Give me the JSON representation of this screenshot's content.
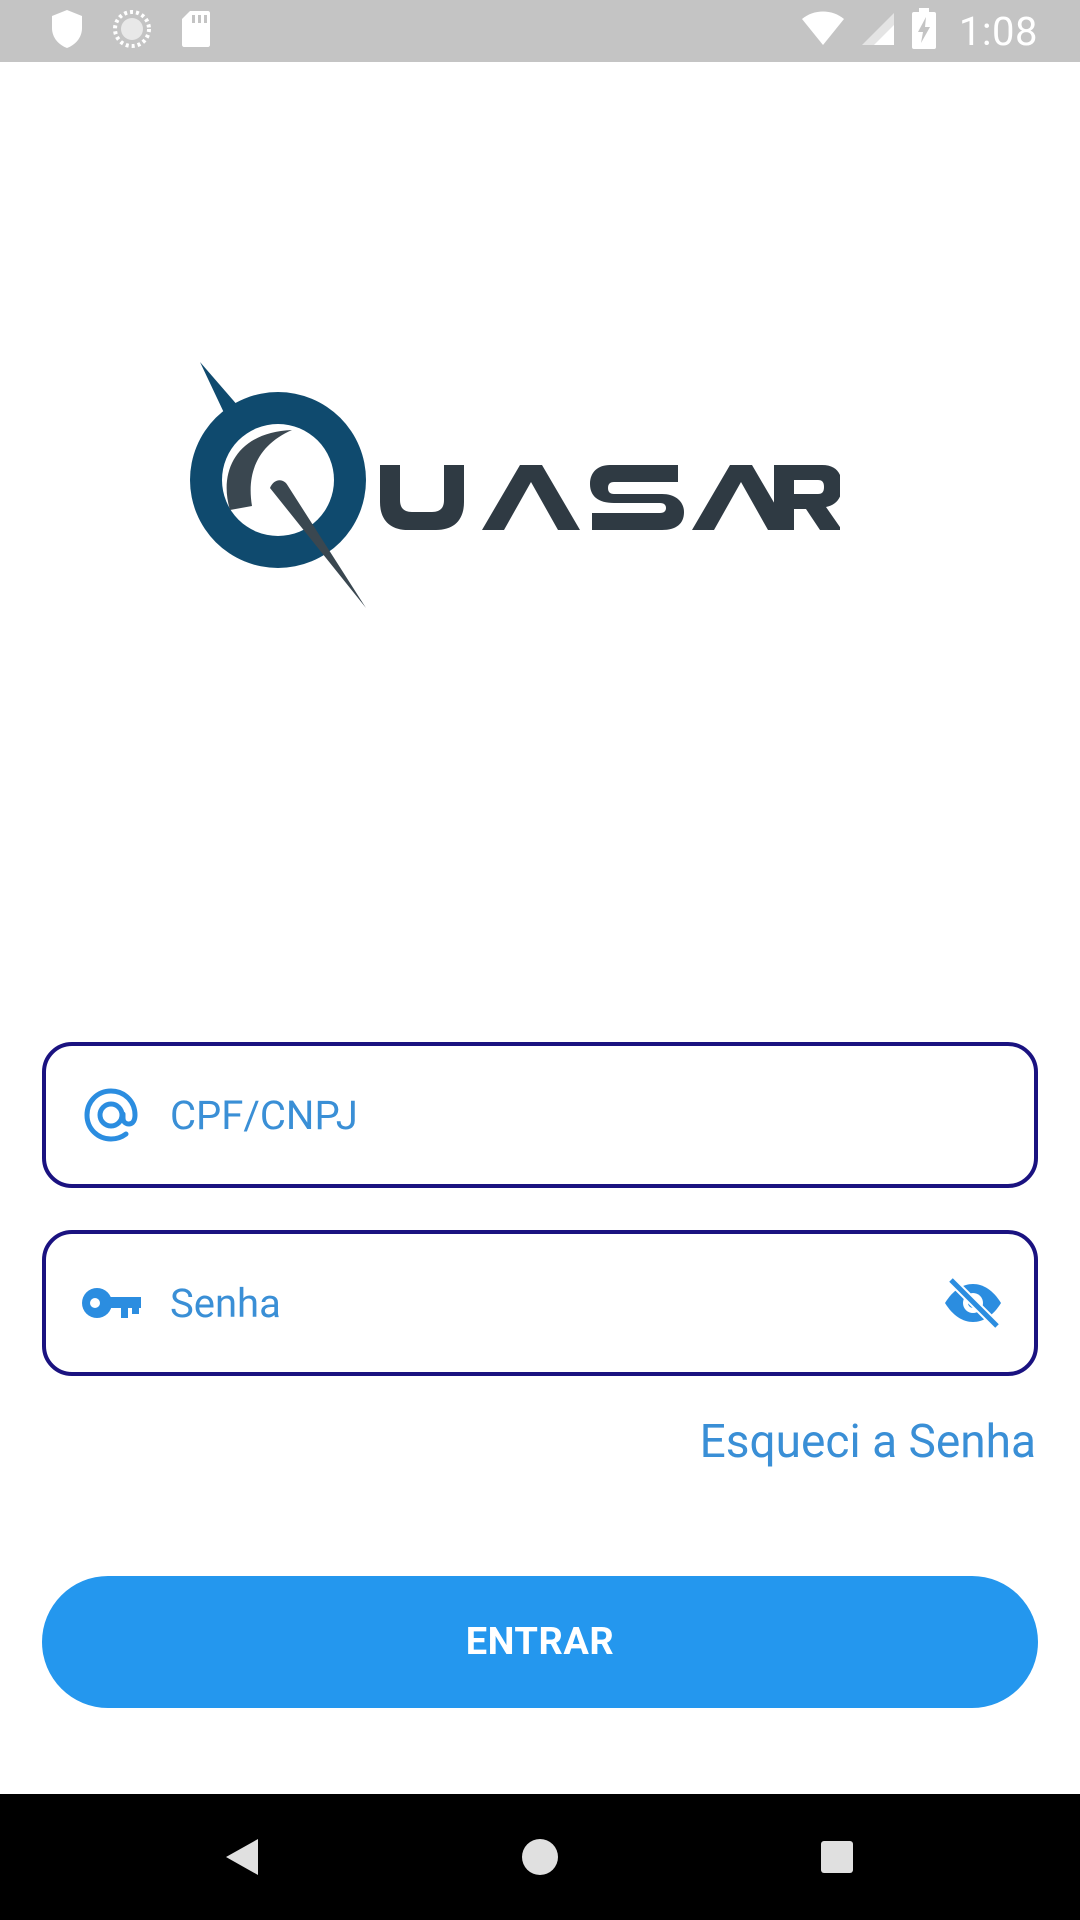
{
  "status_bar": {
    "time": "1:08",
    "icons": [
      "shield-icon",
      "loading-circle-icon",
      "sd-card-icon",
      "wifi-icon",
      "signal-icon",
      "battery-charging-icon"
    ]
  },
  "logo": {
    "text": "QUASAR",
    "colors": {
      "ring": "#0f4a6e",
      "letters": "#2f3a43"
    }
  },
  "login": {
    "user_placeholder": "CPF/CNPJ",
    "user_value": "",
    "password_placeholder": "Senha",
    "password_value": "",
    "forgot_label": "Esqueci a Senha",
    "submit_label": "ENTRAR"
  },
  "colors": {
    "accent": "#2497ee",
    "field_border": "#1a1280",
    "icon": "#2b8de0",
    "status_bar": "#c4c4c4"
  },
  "nav_bar": {
    "buttons": [
      "back-icon",
      "home-icon",
      "recents-icon"
    ]
  }
}
